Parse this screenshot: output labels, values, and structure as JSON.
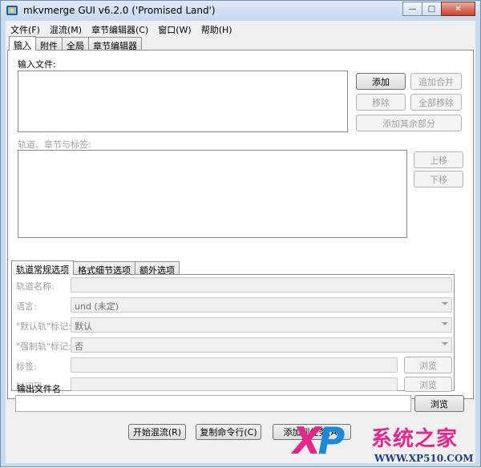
{
  "window": {
    "title": "mkvmerge GUI v6.2.0 ('Promised Land')",
    "caption_buttons": {
      "minimize": "—",
      "maximize": "□",
      "close": "✕"
    }
  },
  "menubar": {
    "items": [
      {
        "label": "文件(F)"
      },
      {
        "label": "混流(M)"
      },
      {
        "label": "章节编辑器(C)"
      },
      {
        "label": "窗口(W)"
      },
      {
        "label": "帮助(H)"
      }
    ]
  },
  "main_tabs": [
    {
      "label": "输入",
      "active": true
    },
    {
      "label": "附件",
      "active": false
    },
    {
      "label": "全局",
      "active": false
    },
    {
      "label": "章节编辑器",
      "active": false
    }
  ],
  "input_tab": {
    "input_files_label": "输入文件:",
    "buttons": {
      "add": "添加",
      "append": "追加合并",
      "remove": "移除",
      "remove_all": "全部移除",
      "add_additional_parts": "添加其余部分"
    },
    "tracks_label": "轨道、章节与标签:",
    "move_up": "上移",
    "move_down": "下移"
  },
  "track_tabs": [
    {
      "label": "轨道常规选项",
      "active": true
    },
    {
      "label": "格式细节选项",
      "active": false
    },
    {
      "label": "额外选项",
      "active": false
    }
  ],
  "track_options": {
    "track_name_label": "轨道名称:",
    "track_name_value": "",
    "language_label": "语言:",
    "language_value": "und (未定)",
    "default_track_label": "\"默认轨\"标记:",
    "default_track_value": "默认",
    "forced_track_label": "\"强制轨\"标记:",
    "forced_track_value": "否",
    "tags_label": "标签:",
    "tags_value": "",
    "tags_browse": "浏览",
    "timecodes_label": "时间码:",
    "timecodes_value": "",
    "timecodes_browse": "浏览"
  },
  "output": {
    "label": "输出文件名",
    "value": "",
    "browse": "浏览"
  },
  "bottom_buttons": {
    "start_muxing": "开始混流(R)",
    "copy_command": "复制命令行(C)",
    "add_to_queue": "添加到任务(A)"
  },
  "watermark": {
    "xp": "X",
    "xp2": "P",
    "cn_text": "系统之家",
    "url": "WWW.XP510.COM"
  },
  "colors": {
    "title_bar": "#c4d8ee",
    "close_button": "#c7452e",
    "watermark_pink": "#e6268b",
    "watermark_blue": "#1c8ad9"
  }
}
